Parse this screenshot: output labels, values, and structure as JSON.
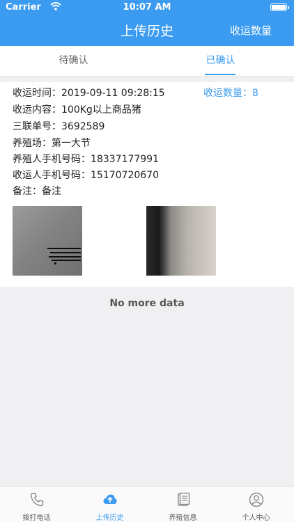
{
  "status_bar": {
    "carrier": "Carrier",
    "time": "10:07 AM"
  },
  "header": {
    "title": "上传历史",
    "right_action": "收运数量"
  },
  "tabs": [
    {
      "label": "待确认",
      "active": false
    },
    {
      "label": "已确认",
      "active": true
    }
  ],
  "record": {
    "time": "收运时间：2019-09-11 09:28:15",
    "count": "收运数量：8",
    "content": "收运内容：100Kg以上商品猪",
    "form_no": "三联单号：3692589",
    "farm": "养殖场：第一大节",
    "farmer_phone": "养殖人手机号码：18337177991",
    "collector_phone": "收运人手机号码：15170720670",
    "remark": "备注：备注"
  },
  "list_footer": "No more data",
  "bottom_nav": [
    {
      "label": "拨打电话",
      "icon": "phone-icon",
      "active": false
    },
    {
      "label": "上传历史",
      "icon": "cloud-upload-icon",
      "active": true
    },
    {
      "label": "养殖信息",
      "icon": "document-icon",
      "active": false
    },
    {
      "label": "个人中心",
      "icon": "user-icon",
      "active": false
    }
  ],
  "colors": {
    "accent": "#3a9bf0",
    "page_bg": "#f0f0f2",
    "text": "#222222"
  }
}
